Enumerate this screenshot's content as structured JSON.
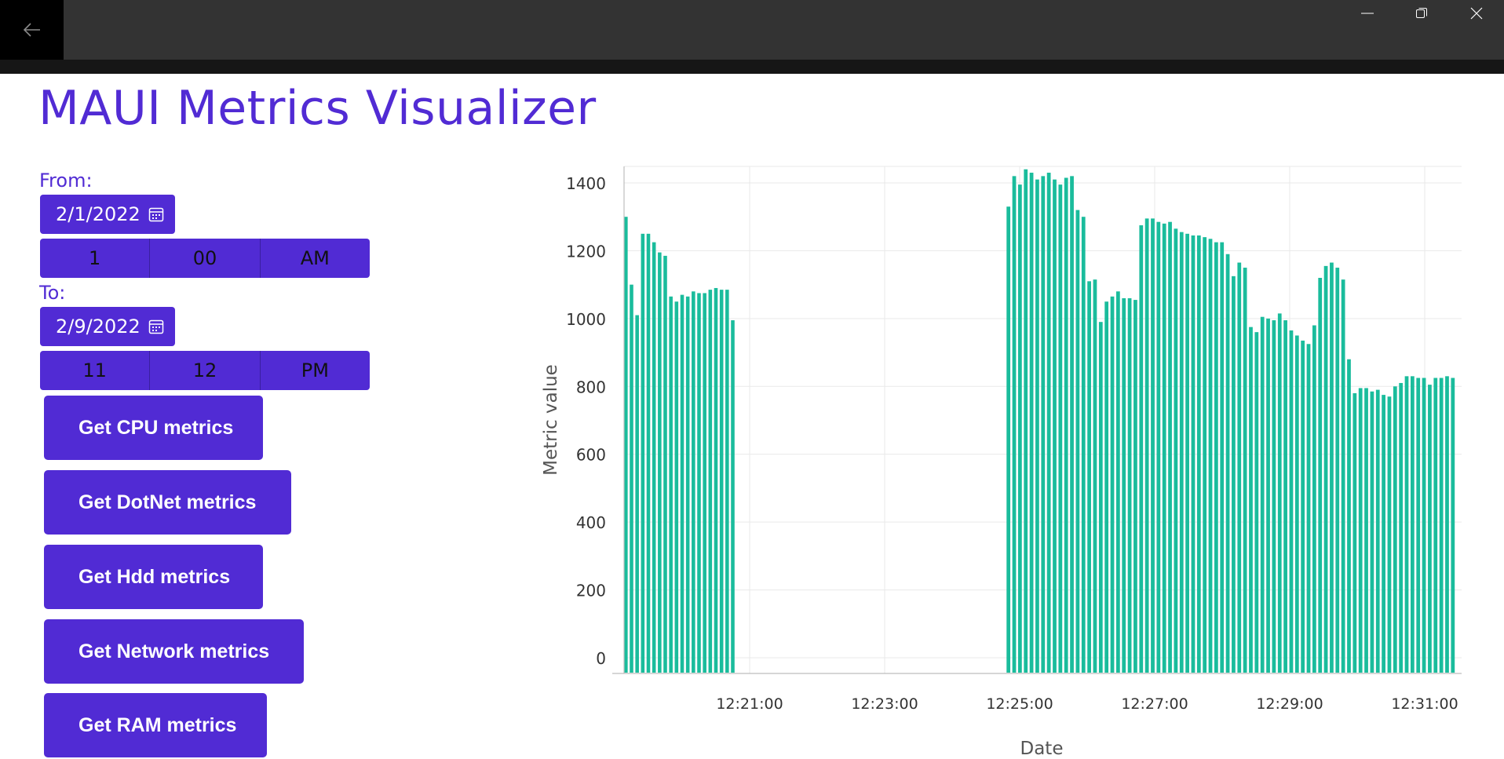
{
  "window": {
    "back_icon": "arrow-left-icon",
    "minimize_icon": "minimize-icon",
    "restore_icon": "restore-icon",
    "close_icon": "close-icon"
  },
  "app": {
    "title": "MAUI Metrics Visualizer",
    "accent": "#512BD4"
  },
  "from": {
    "label": "From:",
    "date": "2/1/2022",
    "hour": "1",
    "minute": "00",
    "ampm": "AM"
  },
  "to": {
    "label": "To:",
    "date": "2/9/2022",
    "hour": "11",
    "minute": "12",
    "ampm": "PM"
  },
  "buttons": [
    "Get CPU metrics",
    "Get DotNet metrics",
    "Get Hdd metrics",
    "Get Network metrics",
    "Get RAM metrics"
  ],
  "chart_data": {
    "type": "bar",
    "xlabel": "Date",
    "ylabel": "Metric value",
    "ylim": [
      0,
      1400
    ],
    "yticks": [
      0,
      200,
      400,
      600,
      800,
      1000,
      1200,
      1400
    ],
    "xticks": [
      "12:21:00",
      "12:23:00",
      "12:25:00",
      "12:27:00",
      "12:29:00",
      "12:31:00"
    ],
    "grid": true,
    "bar_color": "#1ABC9C",
    "series": [
      {
        "x_range": [
          "12:19:10",
          "12:20:45"
        ],
        "values": [
          1300,
          1100,
          1010,
          1250,
          1250,
          1225,
          1195,
          1185,
          1065,
          1050,
          1070,
          1065,
          1080,
          1075,
          1075,
          1085,
          1090,
          1085,
          1085,
          995
        ]
      },
      {
        "x_range": [
          "12:24:50",
          "12:31:25"
        ],
        "values": [
          1330,
          1420,
          1395,
          1440,
          1430,
          1410,
          1420,
          1430,
          1410,
          1395,
          1415,
          1420,
          1320,
          1300,
          1110,
          1115,
          990,
          1050,
          1065,
          1080,
          1060,
          1060,
          1055,
          1275,
          1295,
          1295,
          1285,
          1280,
          1285,
          1265,
          1255,
          1250,
          1245,
          1245,
          1240,
          1235,
          1225,
          1225,
          1190,
          1125,
          1165,
          1150,
          975,
          960,
          1005,
          1000,
          995,
          1015,
          995,
          965,
          950,
          935,
          925,
          980,
          1120,
          1155,
          1165,
          1150,
          1115,
          880,
          780,
          795,
          795,
          785,
          790,
          775,
          770,
          800,
          810,
          830,
          830,
          825,
          825,
          805,
          825,
          825,
          830,
          825
        ]
      }
    ]
  }
}
